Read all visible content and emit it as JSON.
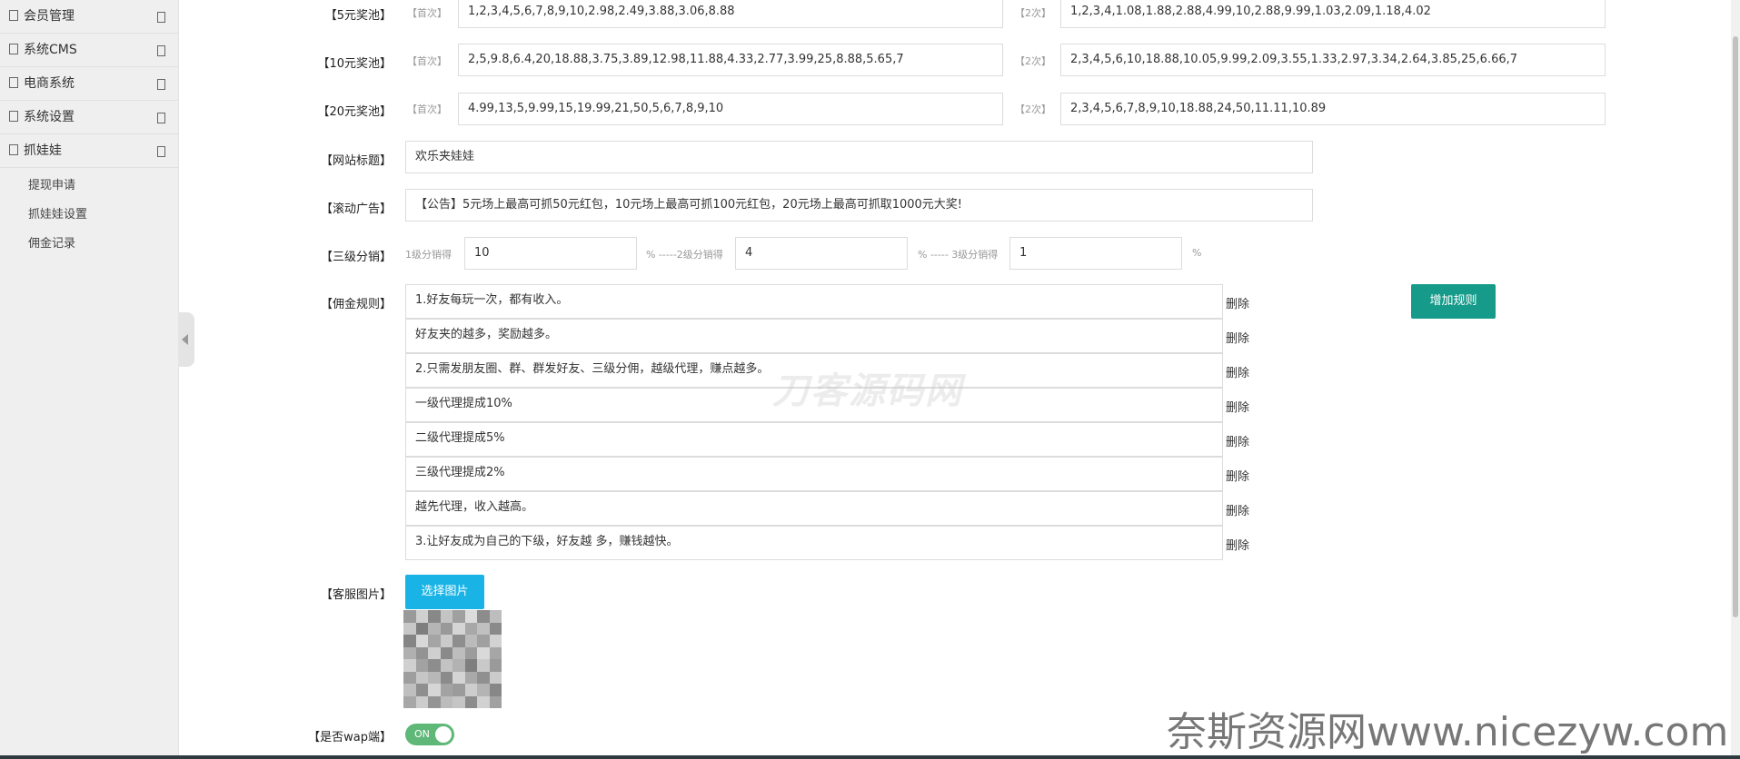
{
  "sidebar": {
    "menu": [
      "会员管理",
      "系统CMS",
      "电商系统",
      "系统设置",
      "抓娃娃"
    ],
    "submenu": [
      "提现申请",
      "抓娃娃设置",
      "佣金记录"
    ]
  },
  "form": {
    "pool5": {
      "label": "【5元奖池】",
      "first_hint": "【首次】",
      "first_value": "1,2,3,4,5,6,7,8,9,10,2.98,2.49,3.88,3.06,8.88",
      "second_hint": "【2次】",
      "second_value": "1,2,3,4,1.08,1.88,2.88,4.99,10,2.88,9.99,1.03,2.09,1.18,4.02"
    },
    "pool10": {
      "label": "【10元奖池】",
      "first_hint": "【首次】",
      "first_value": "2,5,9.8,6.4,20,18.88,3.75,3.89,12.98,11.88,4.33,2.77,3.99,25,8.88,5.65,7",
      "second_hint": "【2次】",
      "second_value": "2,3,4,5,6,10,18.88,10.05,9.99,2.09,3.55,1.33,2.97,3.34,2.64,3.85,25,6.66,7"
    },
    "pool20": {
      "label": "【20元奖池】",
      "first_hint": "【首次】",
      "first_value": "4.99,13,5,9.99,15,19.99,21,50,5,6,7,8,9,10",
      "second_hint": "【2次】",
      "second_value": "2,3,4,5,6,7,8,9,10,18.88,24,50,11.11,10.89"
    },
    "site_title": {
      "label": "【网站标题】",
      "value": "欢乐夹娃娃"
    },
    "scroll_ad": {
      "label": "【滚动广告】",
      "value": "【公告】5元场上最高可抓50元红包，10元场上最高可抓100元红包，20元场上最高可抓取1000元大奖!"
    },
    "distribution": {
      "label": "【三级分销】",
      "l1_hint": "1级分销得",
      "l1_value": "10",
      "l2_hint": "% -----2级分销得",
      "l2_value": "4",
      "l3_hint": "% ----- 3级分销得",
      "l3_value": "1",
      "pct": "%"
    },
    "commission": {
      "label": "【佣金规则】",
      "delete_label": "删除",
      "add_label": "增加规则",
      "rules": [
        "1.好友每玩一次，都有收入。",
        "好友夹的越多，奖励越多。",
        "2.只需发朋友圈、群、群发好友、三级分佣，越级代理，赚点越多。",
        "  一级代理提成10%",
        "  二级代理提成5%",
        "  三级代理提成2%",
        "  越先代理，收入越高。",
        "3.让好友成为自己的下级，好友越          多，赚钱越快。"
      ]
    },
    "service_image": {
      "label": "【客服图片】",
      "button": "选择图片"
    },
    "wap": {
      "label": "【是否wap端】",
      "toggle_text": "ON"
    }
  },
  "watermarks": {
    "center": "刀客源码网",
    "bottom_right": "奈斯资源网www.nicezyw.com"
  }
}
